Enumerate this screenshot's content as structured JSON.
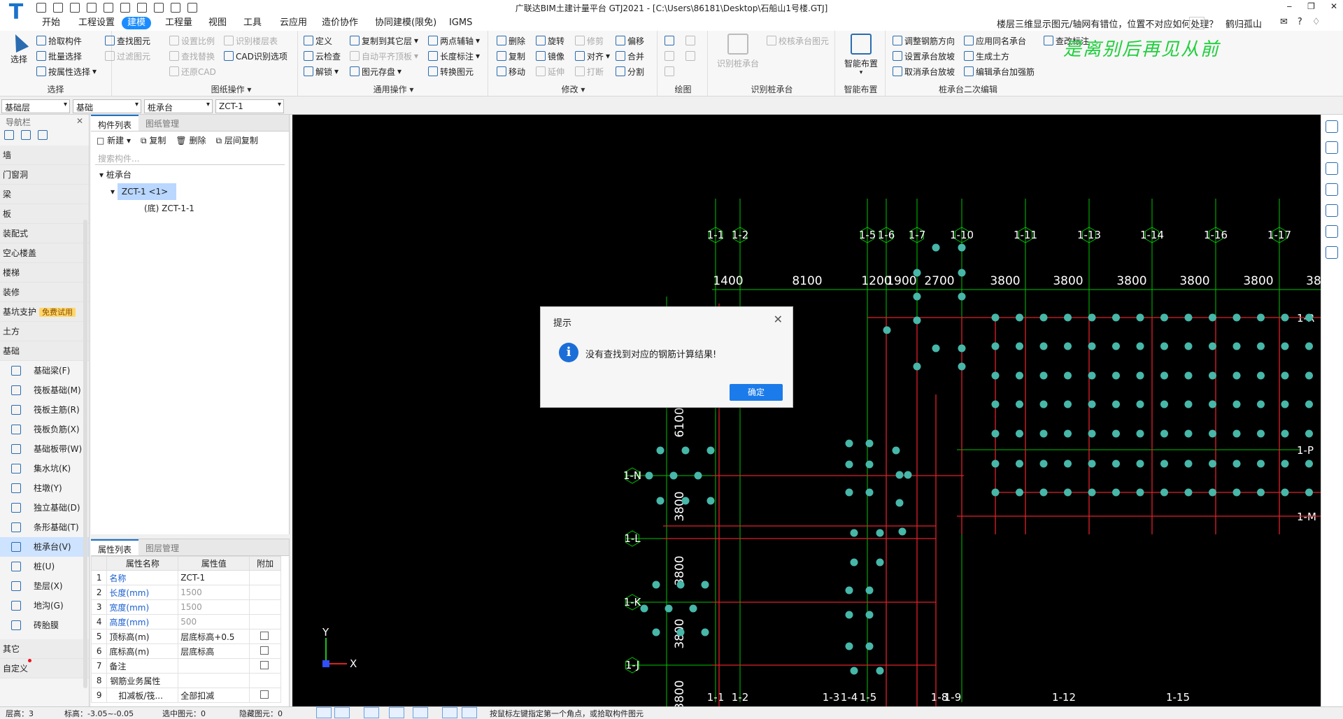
{
  "titlebar": {
    "app_logo": "T",
    "title": "广联达BIM土建计量平台 GTJ2021 - [C:\\Users\\86181\\Desktop\\石船山1号楼.GTJ]",
    "help_question": "楼层三维显示图元/轴网有错位，位置不对应如何处理？",
    "user": "鹤归孤山",
    "window_controls": [
      "‒",
      "❐",
      "✕"
    ]
  },
  "menu": {
    "items": [
      "开始",
      "工程设置",
      "建模",
      "工程量",
      "视图",
      "工具",
      "云应用",
      "造价协作",
      "协同建模(限免)",
      "IGMS"
    ],
    "active_index": 2
  },
  "ribbon": {
    "select_group": {
      "title": "选择",
      "big_label": "选择",
      "cmds": [
        "拾取构件",
        "批量选择",
        "按属性选择"
      ]
    },
    "view_group": {
      "cmds": [
        "查找图元",
        "过滤图元"
      ]
    },
    "drawing_group": {
      "title": "图纸操作",
      "cmds": [
        "设置比例",
        "识别楼层表",
        "查找替换",
        "CAD识别选项",
        "还原CAD"
      ]
    },
    "general_group": {
      "title": "通用操作",
      "cmds": [
        "定义",
        "复制到其它层",
        "两点辅轴",
        "云检查",
        "自动平齐顶板",
        "长度标注",
        "锁定",
        "图元存盘",
        "转换图元",
        "解锁"
      ]
    },
    "modify_group": {
      "title": "修改",
      "cmds": [
        "删除",
        "旋转",
        "修剪",
        "偏移",
        "复制",
        "镜像",
        "对齐",
        "合并",
        "移动",
        "延伸",
        "打断",
        "分割"
      ]
    },
    "draw_group": {
      "title": "绘图"
    },
    "recognize_group": {
      "title": "识别桩承台",
      "big_label": "识别桩承台",
      "cmds": [
        "校核承台图元"
      ]
    },
    "smart_group": {
      "title": "智能布置",
      "big_label": "智能布置"
    },
    "edit_group": {
      "title": "桩承台二次编辑",
      "cmds": [
        "调整钢筋方向",
        "应用同名承台",
        "查改标注",
        "设置承台放坡",
        "生成土方",
        "取消承台放坡",
        "编辑承台加强筋"
      ]
    },
    "slogan": "是离别后再见从前"
  },
  "selectors": [
    "基础层",
    "基础",
    "桩承台",
    "ZCT-1"
  ],
  "nav": {
    "header": "导航栏",
    "categories_top": [
      "墙",
      "门窗洞",
      "梁",
      "板",
      "装配式",
      "空心楼盖",
      "楼梯",
      "装修"
    ],
    "pit_support": "基坑支护",
    "free_badge": "免费试用",
    "earth": "土方",
    "foundation": "基础",
    "foundation_items": [
      "基础梁(F)",
      "筏板基础(M)",
      "筏板主筋(R)",
      "筏板负筋(X)",
      "基础板带(W)",
      "集水坑(K)",
      "柱墩(Y)",
      "独立基础(D)",
      "条形基础(T)",
      "桩承台(V)",
      "桩(U)",
      "垫层(X)",
      "地沟(G)",
      "砖胎膜"
    ],
    "active_item": "桩承台(V)",
    "others": [
      "其它",
      "自定义"
    ]
  },
  "component_panel": {
    "tabs": [
      "构件列表",
      "图纸管理"
    ],
    "tools": [
      "新建",
      "复制",
      "删除",
      "层间复制"
    ],
    "search_placeholder": "搜索构件...",
    "tree": {
      "root": "桩承台",
      "item": "ZCT-1 <1>",
      "child": "(底) ZCT-1-1"
    }
  },
  "property_panel": {
    "tabs": [
      "属性列表",
      "图层管理"
    ],
    "headers": [
      "属性名称",
      "属性值",
      "附加"
    ],
    "rows": [
      {
        "no": "1",
        "name": "名称",
        "value": "ZCT-1",
        "blue": true,
        "gray": false,
        "chk": false
      },
      {
        "no": "2",
        "name": "长度(mm)",
        "value": "1500",
        "blue": true,
        "gray": true,
        "chk": false
      },
      {
        "no": "3",
        "name": "宽度(mm)",
        "value": "1500",
        "blue": true,
        "gray": true,
        "chk": false
      },
      {
        "no": "4",
        "name": "高度(mm)",
        "value": "500",
        "blue": true,
        "gray": true,
        "chk": false
      },
      {
        "no": "5",
        "name": "顶标高(m)",
        "value": "层底标高+0.5",
        "blue": false,
        "gray": false,
        "chk": true
      },
      {
        "no": "6",
        "name": "底标高(m)",
        "value": "层底标高",
        "blue": false,
        "gray": false,
        "chk": true
      },
      {
        "no": "7",
        "name": "备注",
        "value": "",
        "blue": false,
        "gray": false,
        "chk": true
      },
      {
        "no": "8",
        "name": "钢筋业务属性",
        "value": "",
        "blue": false,
        "gray": false,
        "chk": false
      },
      {
        "no": "9",
        "name": "扣减板/筏...",
        "value": "全部扣减",
        "blue": false,
        "gray": false,
        "chk": true
      }
    ]
  },
  "canvas": {
    "top_axes": [
      "1-1",
      "1-2",
      "1-5",
      "1-6",
      "1-7",
      "1-10",
      "1-11",
      "1-13",
      "1-14",
      "1-16",
      "1-17"
    ],
    "top_dims": [
      "1400",
      "8100",
      "1200",
      "1900",
      "2700",
      "3800",
      "3800",
      "3800",
      "3800",
      "3800",
      "38"
    ],
    "bottom_axes": [
      "1-1",
      "1-2",
      "1-3",
      "1-4",
      "1-5",
      "1-8",
      "1-9",
      "1-12",
      "1-15"
    ],
    "left_axes": [
      "1-N",
      "1-L",
      "1-K",
      "1-J"
    ],
    "left_dims": [
      "6100",
      "3800",
      "3800",
      "3800",
      "3800"
    ],
    "right_axes": [
      "1-R",
      "1-P",
      "1-M"
    ],
    "ucs_x": "X",
    "ucs_y": "Y",
    "colors": {
      "axis": "#00c400",
      "beam": "#e0202a",
      "pile": "#46b7a8",
      "bg": "#000000"
    }
  },
  "status": {
    "floor": "层高：3",
    "elev": "标高：-3.05~-0.05",
    "selected": "选中图元：0",
    "hidden": "隐藏图元：0",
    "hint": "按鼠标左键指定第一个角点，或拾取构件图元"
  },
  "dialog": {
    "title": "提示",
    "message": "没有查找到对应的钢筋计算结果!",
    "ok": "确定",
    "icon": "info-icon"
  }
}
